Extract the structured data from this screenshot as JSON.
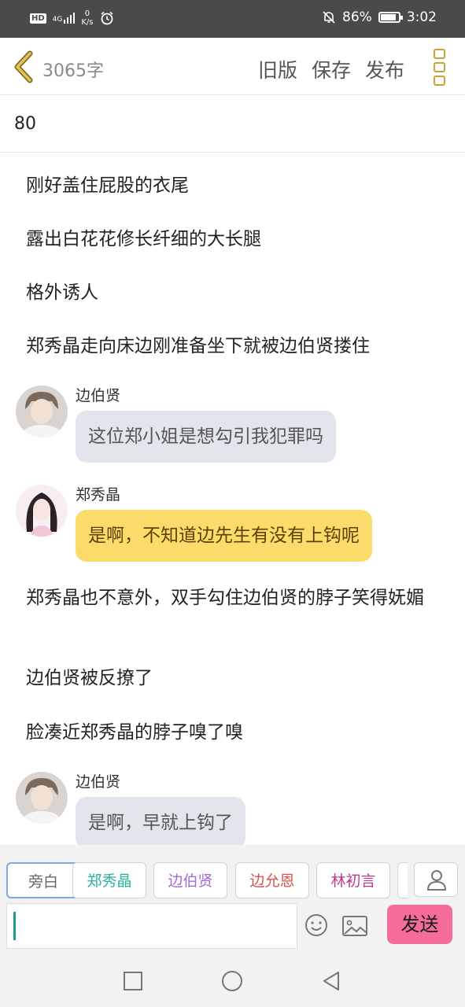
{
  "status_bar": {
    "hd": "HD",
    "signal": "4G",
    "speed_value": "0",
    "speed_unit": "K/s",
    "battery": "86%",
    "time": "3:02",
    "battery_level": 0.86
  },
  "header": {
    "word_count": "3065字",
    "old_version": "旧版",
    "save": "保存",
    "publish": "发布",
    "back_icon": "chevron-left-icon",
    "more_icon": "more-vertical-icon"
  },
  "chapter": {
    "number": "80"
  },
  "content": {
    "paragraphs_top": [
      "刚好盖住屁股的衣尾",
      "露出白花花修长纤细的大长腿",
      "格外诱人",
      "郑秀晶走向床边刚准备坐下就被边伯贤搂住"
    ],
    "messages": [
      {
        "speaker": "边伯贤",
        "text": "这位郑小姐是想勾引我犯罪吗",
        "style": "grey"
      },
      {
        "speaker": "郑秀晶",
        "text": "是啊，不知道边先生有没有上钩呢",
        "style": "yellow"
      },
      {
        "speaker": "边伯贤",
        "text": "是啊，早就上钩了",
        "style": "grey"
      }
    ],
    "paragraphs_mid": [
      "郑秀晶也不意外，双手勾住边伯贤的脖子笑得妩媚",
      "边伯贤被反撩了",
      "脸凑近郑秀晶的脖子嗅了嗅"
    ]
  },
  "composer": {
    "roles": [
      {
        "label": "旁白",
        "color": "#666666"
      },
      {
        "label": "郑秀晶",
        "color": "#2bb39b"
      },
      {
        "label": "边伯贤",
        "color": "#a56ad6"
      },
      {
        "label": "边允恩",
        "color": "#d9534f"
      },
      {
        "label": "林初言",
        "color": "#c0398a"
      }
    ],
    "input_value": "",
    "send_label": "发送",
    "send_color": "#f56c98"
  },
  "navbar": {
    "recent_icon": "square-icon",
    "home_icon": "circle-icon",
    "back_icon": "triangle-back-icon"
  }
}
